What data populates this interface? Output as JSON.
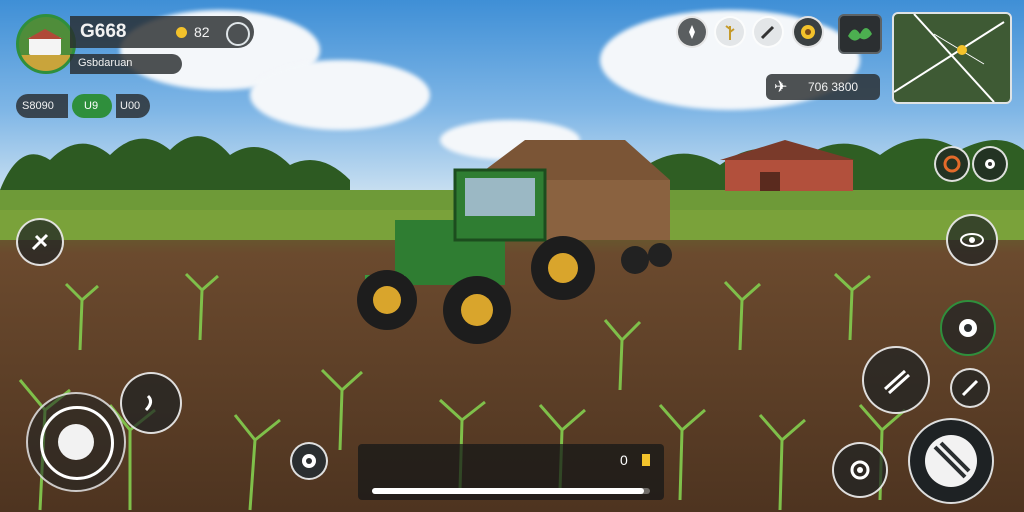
{
  "player": {
    "money": "G668",
    "resource_value": "82",
    "name": "Gsbdaruan"
  },
  "stats": {
    "left": "S8090",
    "middle": "U9",
    "right": "U00"
  },
  "top_icons": [
    "compass-icon",
    "wheat-icon",
    "pencil-icon",
    "sunflower-icon",
    "plant-icon"
  ],
  "counter": {
    "value": "706 3800"
  },
  "progress": {
    "value_label": "0",
    "fill_fraction": 0.98
  },
  "colors": {
    "accent_green": "#2f8f3c",
    "hud_dark": "#2a2e30",
    "map_line": "#ffffff",
    "map_marker": "#f3c22b"
  }
}
